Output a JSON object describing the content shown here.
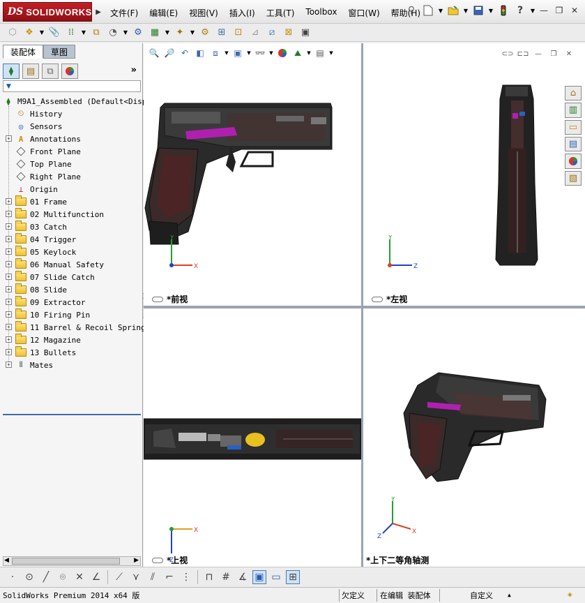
{
  "app": {
    "logo_mark": "DS",
    "logo_name": "SOLIDWORKS"
  },
  "menus": [
    {
      "label": "文件(F)"
    },
    {
      "label": "编辑(E)"
    },
    {
      "label": "视图(V)"
    },
    {
      "label": "插入(I)"
    },
    {
      "label": "工具(T)"
    },
    {
      "label": "Toolbox"
    },
    {
      "label": "窗口(W)"
    },
    {
      "label": "帮助(H)"
    }
  ],
  "quick_access_icons": [
    "pin-icon",
    "new-document-icon",
    "open-folder-icon",
    "save-icon",
    "rebuild-traffic-light-icon",
    "help-icon"
  ],
  "window_controls": [
    "minimize-icon",
    "restore-icon",
    "close-icon"
  ],
  "toolbar_icons": [
    "insert-component-icon",
    "smart-fastener-icon",
    "mate-icon",
    "linear-pattern-icon",
    "move-component-icon",
    "show-hidden-icon",
    "assembly-features-icon",
    "reference-geometry-icon",
    "new-motion-study-icon",
    "bill-of-materials-icon",
    "exploded-view-icon",
    "explode-line-sketch-icon",
    "interference-detection-icon",
    "clearance-verification-icon",
    "hole-alignment-icon",
    "measure-icon",
    "mass-properties-icon"
  ],
  "left_panel": {
    "tabs": [
      {
        "label": "装配体",
        "active": true
      },
      {
        "label": "草图",
        "active": false
      }
    ],
    "panel_icons": [
      "feature-manager-icon",
      "property-manager-icon",
      "configuration-manager-icon",
      "display-manager-icon"
    ],
    "expand_symbol": "»",
    "filter_symbol": "▼",
    "tree": [
      {
        "label": "M9A1_Assembled  (Default<Displ",
        "icon": "assembly-icon",
        "level": 0,
        "expandable": false
      },
      {
        "label": "History",
        "icon": "history-icon",
        "level": 1,
        "expandable": false
      },
      {
        "label": "Sensors",
        "icon": "sensors-icon",
        "level": 1,
        "expandable": false
      },
      {
        "label": "Annotations",
        "icon": "annotations-icon",
        "level": 1,
        "expandable": true
      },
      {
        "label": "Front Plane",
        "icon": "plane-icon",
        "level": 1,
        "expandable": false
      },
      {
        "label": "Top Plane",
        "icon": "plane-icon",
        "level": 1,
        "expandable": false
      },
      {
        "label": "Right Plane",
        "icon": "plane-icon",
        "level": 1,
        "expandable": false
      },
      {
        "label": "Origin",
        "icon": "origin-icon",
        "level": 1,
        "expandable": false
      },
      {
        "label": "01 Frame",
        "icon": "folder-icon",
        "level": 1,
        "expandable": true
      },
      {
        "label": "02 Multifunction",
        "icon": "folder-icon",
        "level": 1,
        "expandable": true
      },
      {
        "label": "03 Catch",
        "icon": "folder-icon",
        "level": 1,
        "expandable": true
      },
      {
        "label": "04 Trigger",
        "icon": "folder-icon",
        "level": 1,
        "expandable": true
      },
      {
        "label": "05 Keylock",
        "icon": "folder-icon",
        "level": 1,
        "expandable": true
      },
      {
        "label": "06 Manual Safety",
        "icon": "folder-icon",
        "level": 1,
        "expandable": true
      },
      {
        "label": "07 Slide Catch",
        "icon": "folder-icon",
        "level": 1,
        "expandable": true
      },
      {
        "label": "08 Slide",
        "icon": "folder-icon",
        "level": 1,
        "expandable": true
      },
      {
        "label": "09 Extractor",
        "icon": "folder-icon",
        "level": 1,
        "expandable": true
      },
      {
        "label": "10 Firing Pin",
        "icon": "folder-icon",
        "level": 1,
        "expandable": true
      },
      {
        "label": "11 Barrel & Recoil Spring",
        "icon": "folder-icon",
        "level": 1,
        "expandable": true
      },
      {
        "label": "12 Magazine",
        "icon": "folder-icon",
        "level": 1,
        "expandable": true
      },
      {
        "label": "13 Bullets",
        "icon": "folder-icon",
        "level": 1,
        "expandable": true
      },
      {
        "label": "Mates",
        "icon": "mates-icon",
        "level": 1,
        "expandable": true
      }
    ]
  },
  "viewports": {
    "front": {
      "label": "*前视",
      "axes": {
        "vertical": "Y",
        "horizontal": "X"
      }
    },
    "left": {
      "label": "*左视",
      "axes": {
        "vertical": "Y",
        "horizontal": "Z"
      }
    },
    "top": {
      "label": "*上视",
      "axes": {
        "vertical": "Z",
        "horizontal": "X"
      }
    },
    "iso": {
      "label": "*上下二等角轴测",
      "axes": {
        "vertical": "Y",
        "horizontal": "X",
        "depth": "Z"
      }
    }
  },
  "heads_up_icons": [
    "zoom-to-fit-icon",
    "zoom-to-area-icon",
    "previous-view-icon",
    "section-view-icon",
    "view-orientation-icon",
    "display-style-icon",
    "hide-show-items-icon",
    "edit-appearance-icon",
    "apply-scene-icon",
    "view-settings-icon"
  ],
  "task_pane_icons": [
    "home-icon",
    "design-library-icon",
    "file-explorer-icon",
    "view-palette-icon",
    "appearances-icon",
    "custom-properties-icon"
  ],
  "sketch_toolbar_icons": [
    "point-icon",
    "circle-icon",
    "line-icon",
    "polygon-icon",
    "trim-icon",
    "extend-icon",
    "offset-icon",
    "mirror-icon",
    "convert-entities-icon",
    "corner-icon",
    "sketch-pattern-icon",
    "smart-dimension-icon",
    "grid-icon",
    "angle-icon",
    "3d-view-icon",
    "single-view-icon",
    "four-view-icon"
  ],
  "status_bar": {
    "product": "SolidWorks Premium 2014 x64 版",
    "constraint": "欠定义",
    "mode": "在编辑 装配体",
    "units": "自定义",
    "units_arrow": "▲"
  },
  "colors": {
    "logo_red": "#c41e24",
    "axis_x": "#e04020",
    "axis_y": "#20a030",
    "axis_z": "#2040d0",
    "slide_magenta": "#b020b0",
    "brass": "#e8c020",
    "tree_selection_line": "#3a6ea8"
  }
}
